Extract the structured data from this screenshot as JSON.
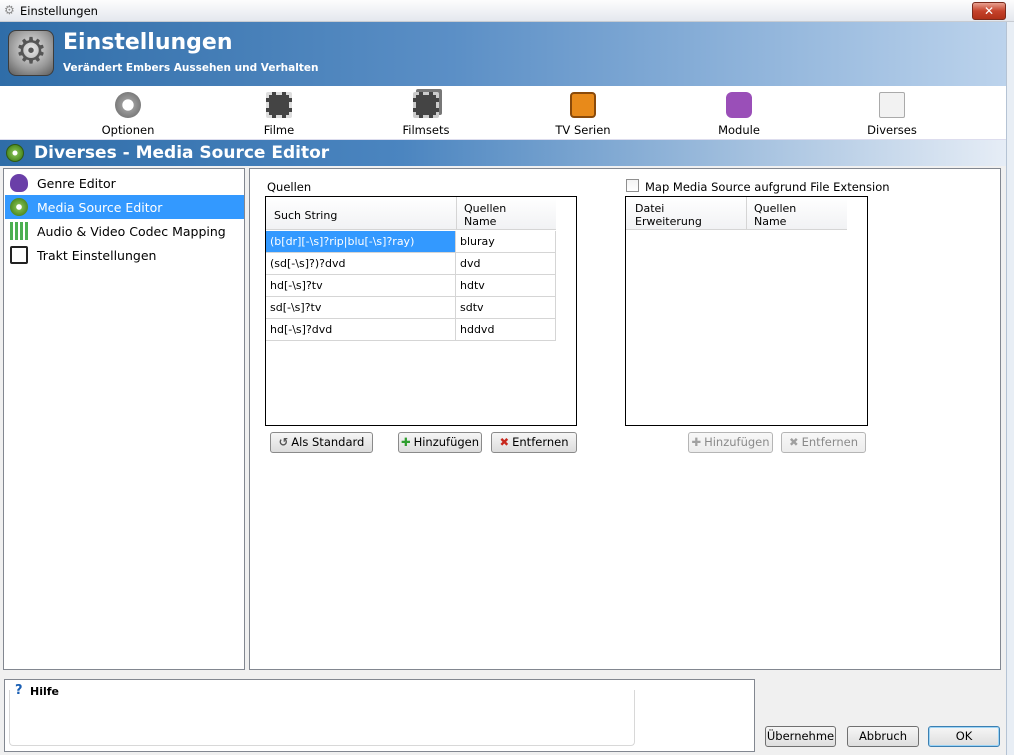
{
  "window": {
    "title": "Einstellungen",
    "close_label": "✕"
  },
  "header": {
    "title": "Einstellungen",
    "subtitle": "Verändert Embers Aussehen und Verhalten",
    "icon": "settings-gear-icon"
  },
  "toolbar": {
    "items": [
      {
        "label": "Optionen",
        "icon": "gear-icon"
      },
      {
        "label": "Filme",
        "icon": "film-icon"
      },
      {
        "label": "Filmsets",
        "icon": "filmset-icon"
      },
      {
        "label": "TV Serien",
        "icon": "tv-icon"
      },
      {
        "label": "Module",
        "icon": "puzzle-icon"
      },
      {
        "label": "Diverses",
        "icon": "document-icon"
      }
    ]
  },
  "section": {
    "title": "Diverses - Media Source Editor",
    "icon": "media-source-icon"
  },
  "sidebar": {
    "items": [
      {
        "label": "Genre Editor",
        "icon": "heart-icon"
      },
      {
        "label": "Media Source Editor",
        "icon": "media-source-icon",
        "selected": true
      },
      {
        "label": "Audio & Video Codec Mapping",
        "icon": "equalizer-icon"
      },
      {
        "label": "Trakt Einstellungen",
        "icon": "trakt-tv-icon"
      }
    ]
  },
  "sources": {
    "group_label": "Quellen",
    "col_search": "Such String",
    "col_name_l1": "Quellen",
    "col_name_l2": "Name",
    "rows": [
      {
        "search": "(b[dr][-\\s]?rip|blu[-\\s]?ray)",
        "name": "bluray"
      },
      {
        "search": "(sd[-\\s]?)?dvd",
        "name": "dvd"
      },
      {
        "search": "hd[-\\s]?tv",
        "name": "hdtv"
      },
      {
        "search": "sd[-\\s]?tv",
        "name": "sdtv"
      },
      {
        "search": "hd[-\\s]?dvd",
        "name": "hddvd"
      }
    ],
    "btn_default": "Als Standard",
    "btn_add": "Hinzufügen",
    "btn_remove": "Entfernen"
  },
  "extension": {
    "checkbox_label": "Map Media Source aufgrund File Extension",
    "checked": false,
    "col_ext_l1": "Datei",
    "col_ext_l2": "Erweiterung",
    "col_name_l1": "Quellen",
    "col_name_l2": "Name",
    "btn_add": "Hinzufügen",
    "btn_remove": "Entfernen"
  },
  "help": {
    "title": "Hilfe",
    "icon": "?"
  },
  "footer": {
    "apply": "Übernehme",
    "cancel": "Abbruch",
    "ok": "OK"
  },
  "colors": {
    "accent": "#3399ff",
    "header": "#2f6da8"
  }
}
